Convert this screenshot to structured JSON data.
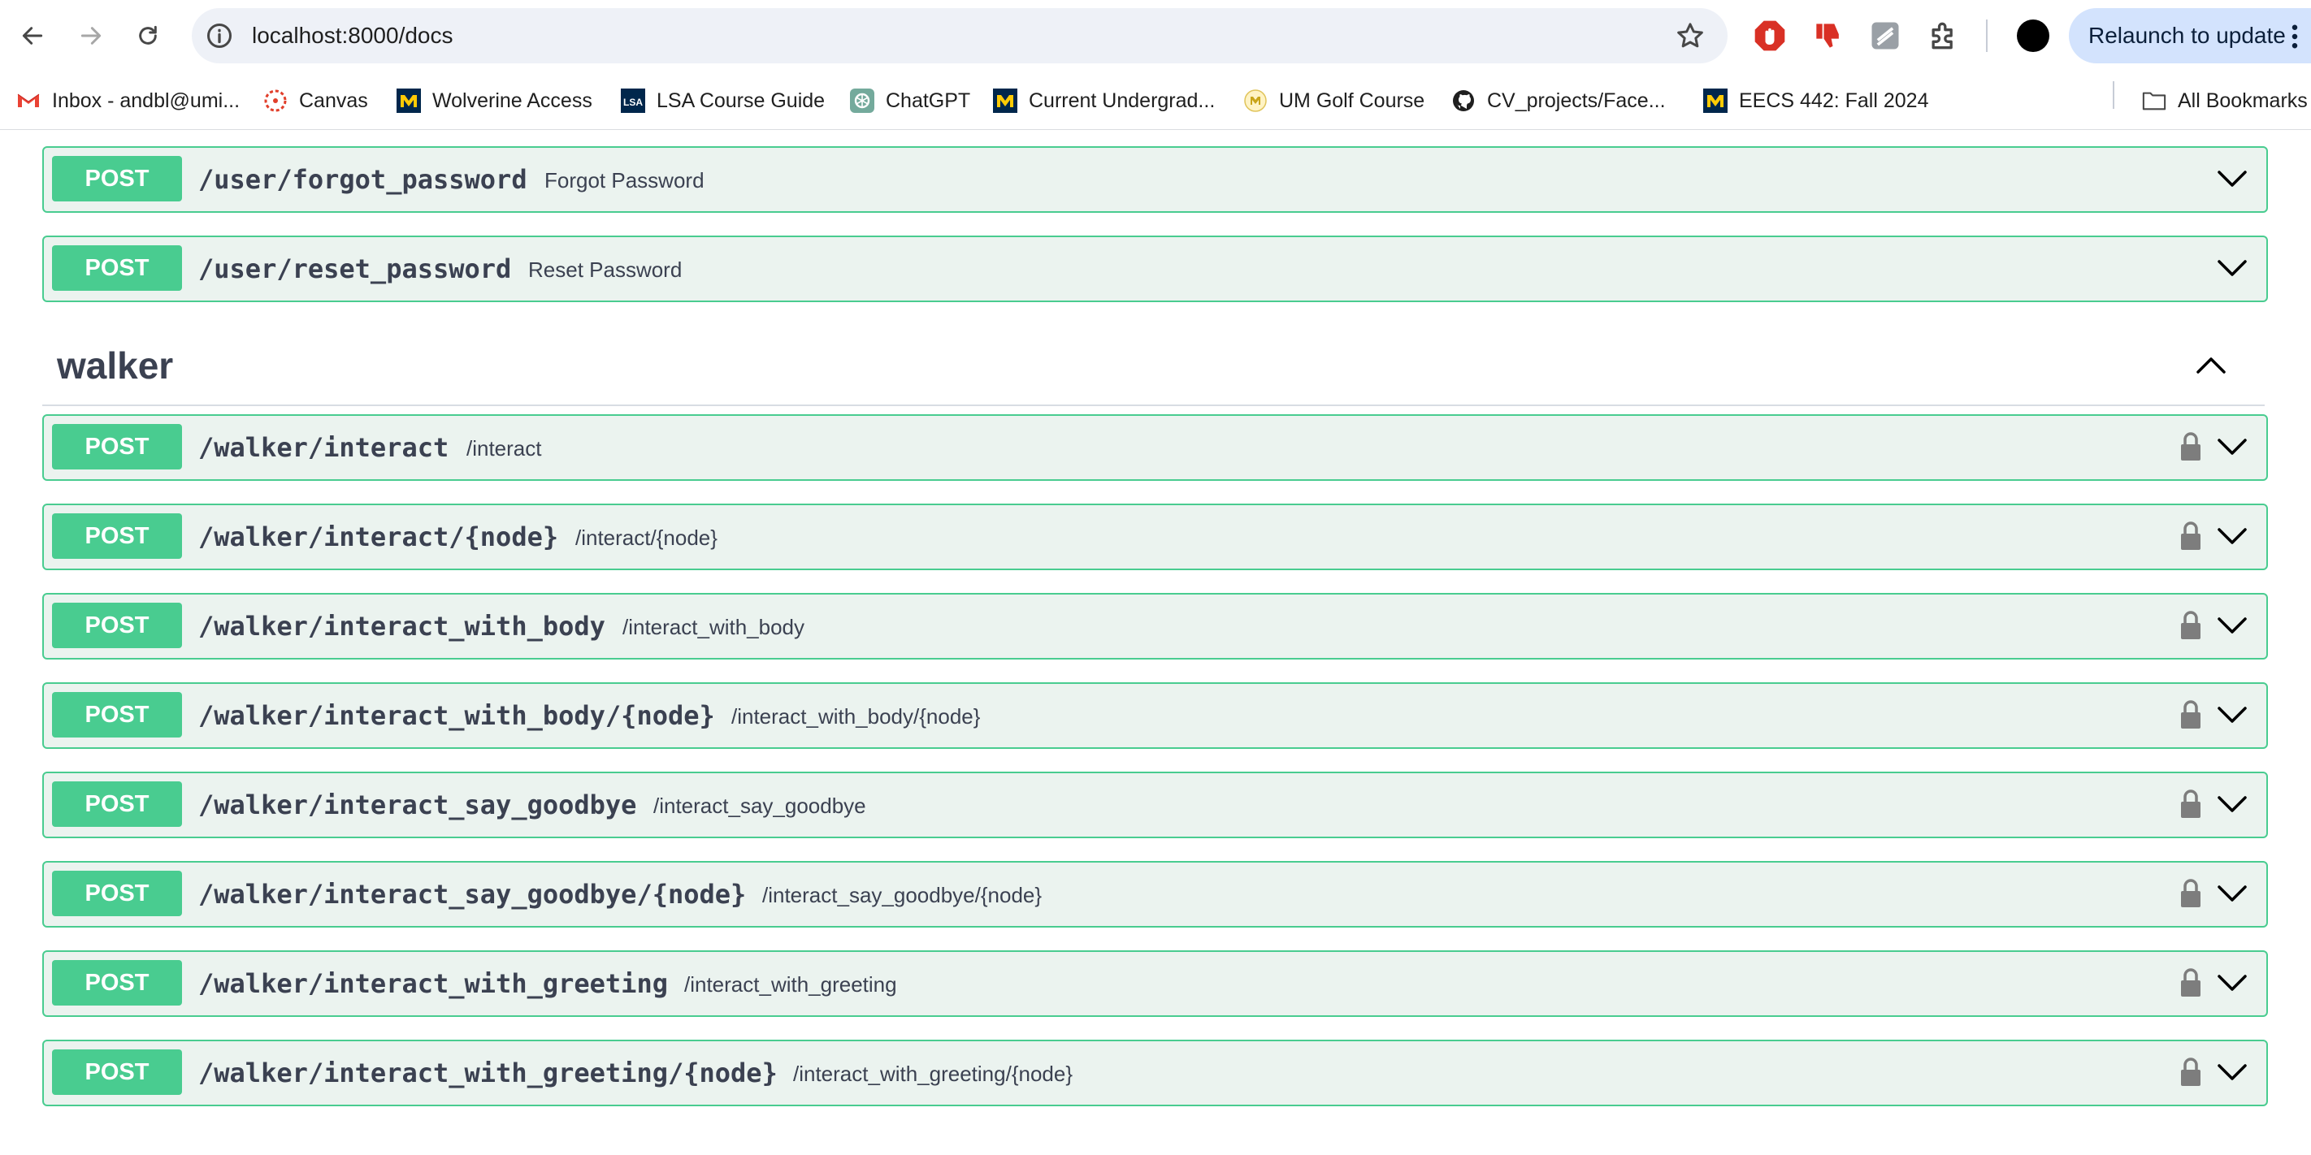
{
  "browser": {
    "url": "localhost:8000/docs",
    "relaunch_label": "Relaunch to update",
    "bookmarks": [
      {
        "label": "Inbox - andbl@umi...",
        "icon": "gmail-icon"
      },
      {
        "label": "Canvas",
        "icon": "canvas-icon"
      },
      {
        "label": "Wolverine Access",
        "icon": "block-m-icon"
      },
      {
        "label": "LSA Course Guide",
        "icon": "lsa-icon"
      },
      {
        "label": "ChatGPT",
        "icon": "chatgpt-icon"
      },
      {
        "label": "Current Undergrad...",
        "icon": "block-m-icon"
      },
      {
        "label": "UM Golf Course",
        "icon": "golf-icon"
      },
      {
        "label": "CV_projects/Face...",
        "icon": "github-icon"
      },
      {
        "label": "EECS 442: Fall 2024",
        "icon": "block-m-icon"
      }
    ],
    "all_bookmarks_label": "All Bookmarks"
  },
  "colors": {
    "post_method": "#49cc90",
    "post_background": "#ebf3ef",
    "text": "#3b4151"
  },
  "user_ops": [
    {
      "method": "POST",
      "path": "/user/forgot_password",
      "summary": "Forgot Password"
    },
    {
      "method": "POST",
      "path": "/user/reset_password",
      "summary": "Reset Password"
    }
  ],
  "walker": {
    "tag": "walker",
    "ops": [
      {
        "method": "POST",
        "path": "/walker/interact",
        "summary": "/interact"
      },
      {
        "method": "POST",
        "path": "/walker/interact/{node}",
        "summary": "/interact/{node}"
      },
      {
        "method": "POST",
        "path": "/walker/interact_with_body",
        "summary": "/interact_with_body"
      },
      {
        "method": "POST",
        "path": "/walker/interact_with_body/{node}",
        "summary": "/interact_with_body/{node}"
      },
      {
        "method": "POST",
        "path": "/walker/interact_say_goodbye",
        "summary": "/interact_say_goodbye"
      },
      {
        "method": "POST",
        "path": "/walker/interact_say_goodbye/{node}",
        "summary": "/interact_say_goodbye/{node}"
      },
      {
        "method": "POST",
        "path": "/walker/interact_with_greeting",
        "summary": "/interact_with_greeting"
      },
      {
        "method": "POST",
        "path": "/walker/interact_with_greeting/{node}",
        "summary": "/interact_with_greeting/{node}"
      }
    ]
  }
}
